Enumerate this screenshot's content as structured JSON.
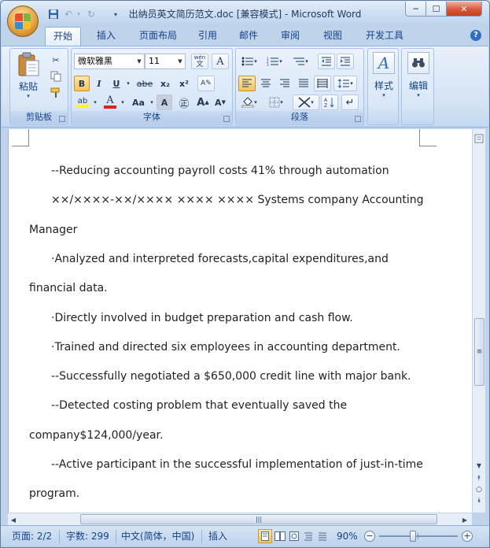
{
  "window": {
    "title": "出纳员英文简历范文.doc [兼容模式] - Microsoft Word",
    "minimize": "─",
    "maximize": "☐",
    "close": "✕"
  },
  "tabs": [
    "开始",
    "插入",
    "页面布局",
    "引用",
    "邮件",
    "审阅",
    "视图",
    "开发工具"
  ],
  "ribbon": {
    "clipboard": {
      "label": "剪贴板",
      "paste": "粘贴"
    },
    "font": {
      "label": "字体",
      "font_name": "微软雅黑",
      "font_size": "11",
      "bold": "B",
      "italic": "I",
      "underline": "U",
      "strike": "abe",
      "sub": "x₂",
      "sup": "x²",
      "grow": "A",
      "shrink": "A",
      "change_case": "Aa"
    },
    "paragraph": {
      "label": "段落"
    },
    "styles": {
      "label": "样式"
    },
    "editing": {
      "label": "编辑"
    }
  },
  "document": {
    "lines": [
      {
        "text": "--Reducing accounting payroll costs 41% through automation",
        "indent": true
      },
      {
        "text": "××/××××-××/××××  ××××  ××××  Systems company Accounting",
        "indent": true
      },
      {
        "text": "Manager",
        "indent": false
      },
      {
        "text": "·Analyzed and interpreted forecasts,capital expenditures,and",
        "indent": true
      },
      {
        "text": "financial data.",
        "indent": false
      },
      {
        "text": "·Directly involved in budget preparation and cash flow.",
        "indent": true
      },
      {
        "text": "·Trained and directed six employees in accounting department.",
        "indent": true
      },
      {
        "text": "--Successfully negotiated a $650,000 credit line with major bank.",
        "indent": true
      },
      {
        "text": "--Detected costing problem that eventually saved the",
        "indent": true
      },
      {
        "text": "company$124,000/year.",
        "indent": false
      },
      {
        "text": "--Active participant in the successful implementation of just-in-time",
        "indent": true
      },
      {
        "text": "program.",
        "indent": false
      }
    ]
  },
  "status": {
    "page": "页面: 2/2",
    "words": "字数: 299",
    "language": "中文(简体，中国)",
    "mode": "插入",
    "zoom": "90%"
  }
}
